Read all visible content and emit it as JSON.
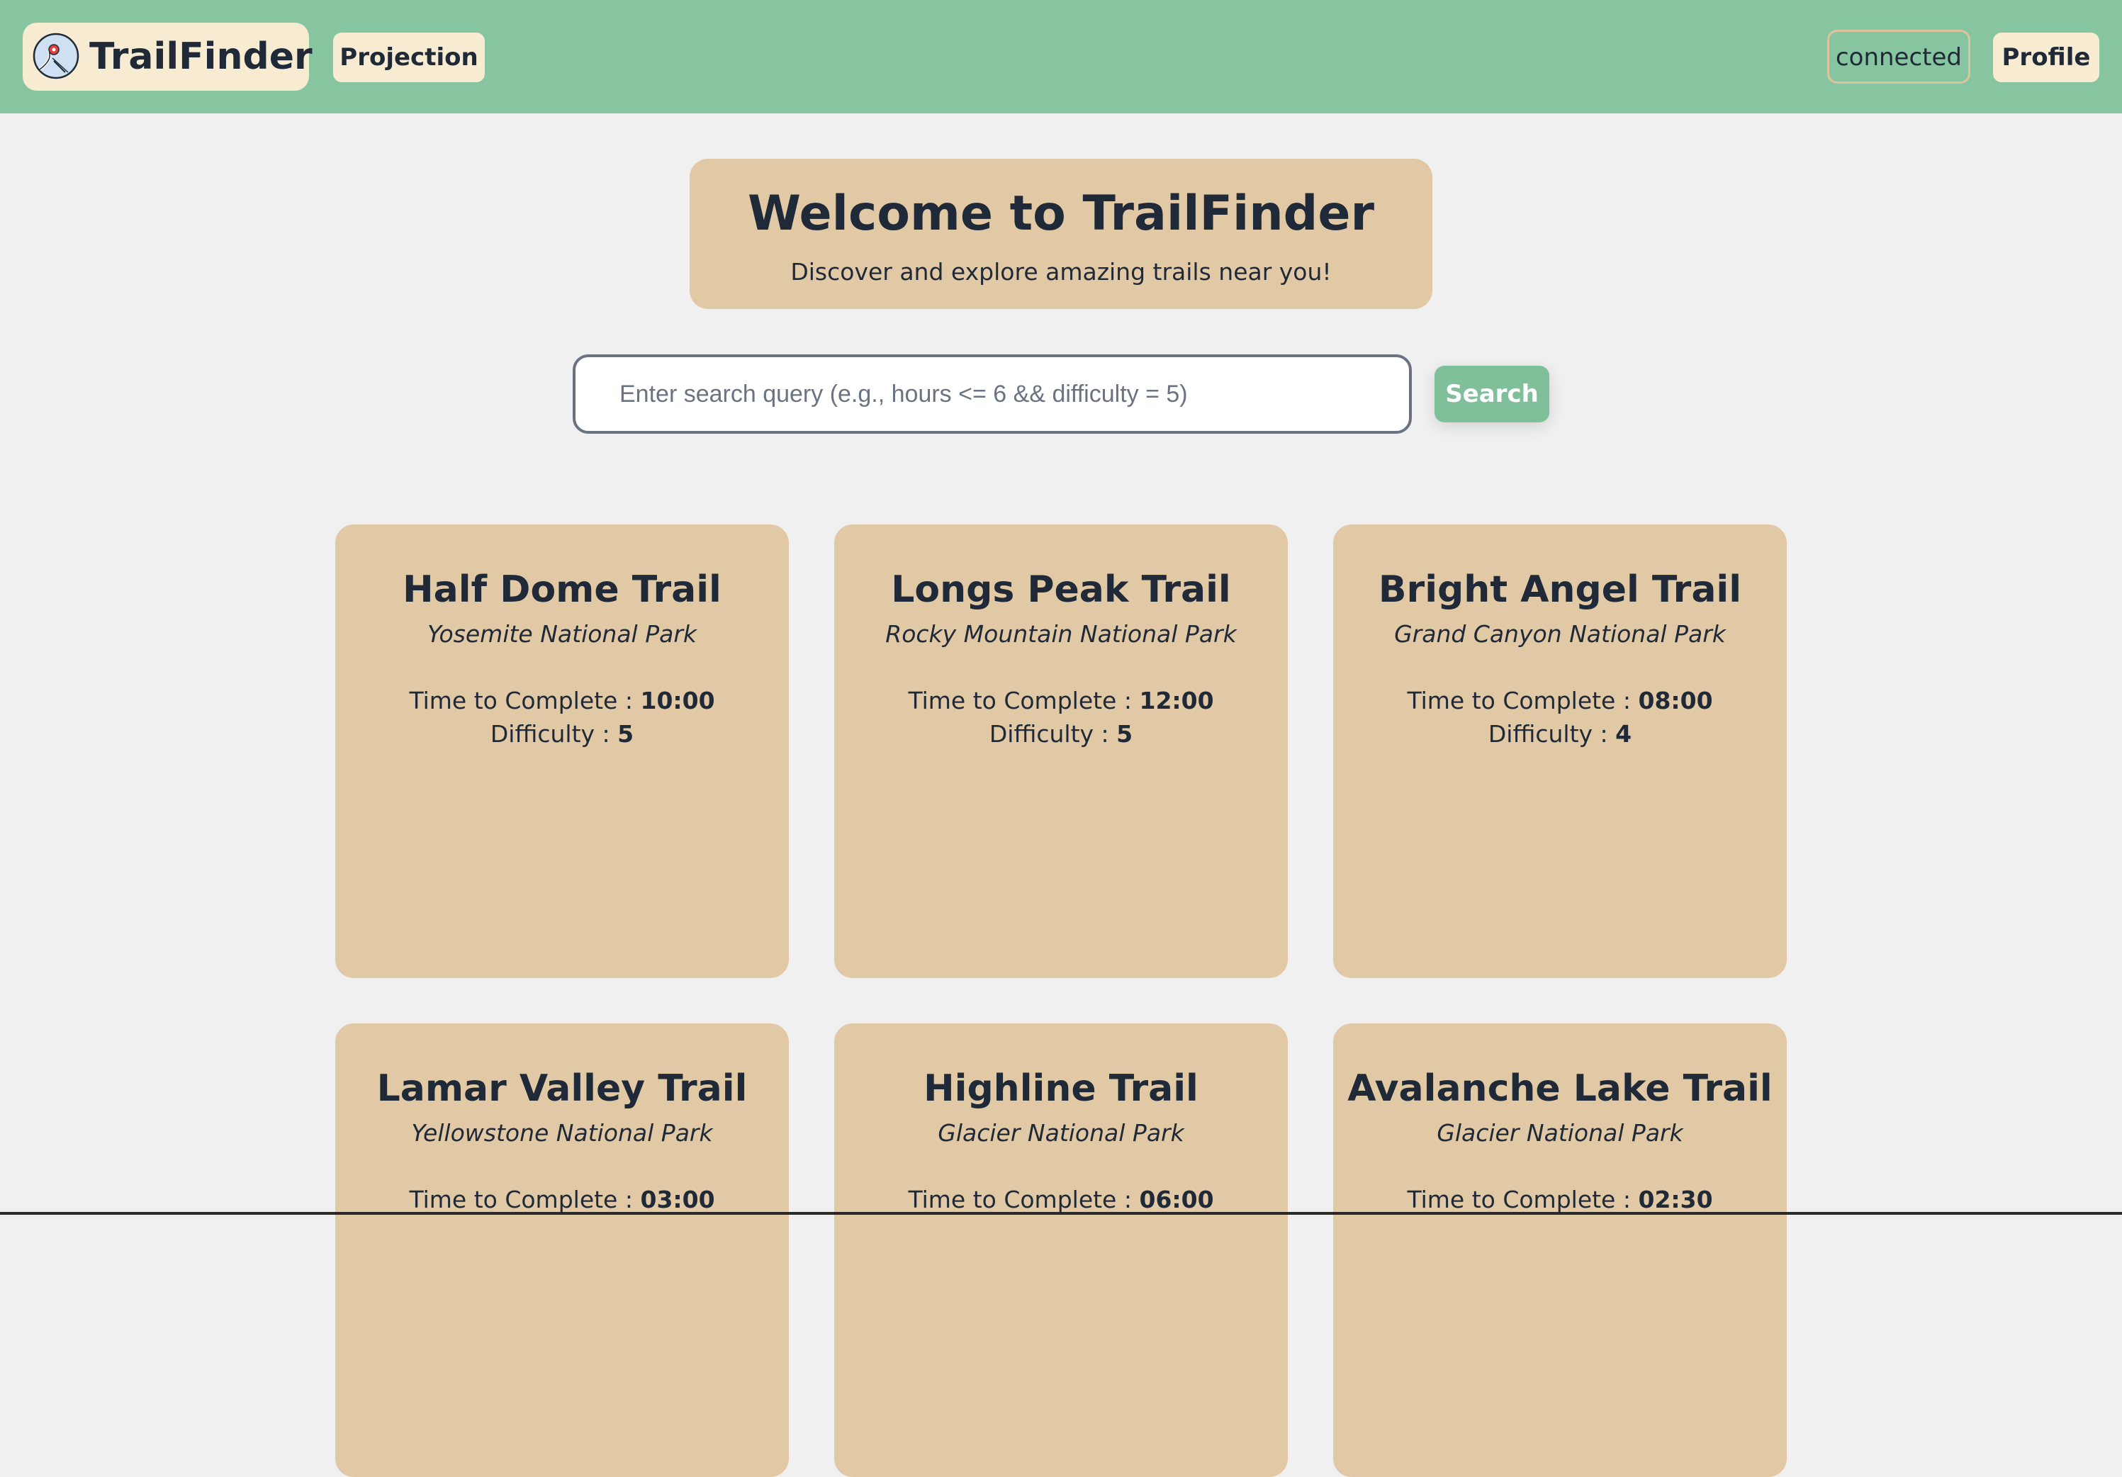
{
  "header": {
    "brand_name": "TrailFinder",
    "logo_icon": "trail-map-pin-logo-icon",
    "nav": {
      "projection_label": "Projection",
      "profile_label": "Profile"
    },
    "status": "connected"
  },
  "hero": {
    "title": "Welcome to TrailFinder",
    "subtitle": "Discover and explore amazing trails near you!"
  },
  "search": {
    "placeholder": "Enter search query (e.g., hours <= 6 && difficulty = 5)",
    "value": "",
    "button_label": "Search"
  },
  "trail_labels": {
    "time": "Time to Complete",
    "difficulty": "Difficulty",
    "separator": ":"
  },
  "trails": [
    {
      "name": "Half Dome Trail",
      "park": "Yosemite National Park",
      "time": "10:00",
      "difficulty": "5"
    },
    {
      "name": "Longs Peak Trail",
      "park": "Rocky Mountain National Park",
      "time": "12:00",
      "difficulty": "5"
    },
    {
      "name": "Bright Angel Trail",
      "park": "Grand Canyon National Park",
      "time": "08:00",
      "difficulty": "4"
    },
    {
      "name": "Lamar Valley Trail",
      "park": "Yellowstone National Park",
      "time": "03:00",
      "difficulty": ""
    },
    {
      "name": "Highline Trail",
      "park": "Glacier National Park",
      "time": "06:00",
      "difficulty": ""
    },
    {
      "name": "Avalanche Lake Trail",
      "park": "Glacier National Park",
      "time": "02:30",
      "difficulty": ""
    }
  ],
  "colors": {
    "header_bg": "#87c5a0",
    "brand_bg": "#f7ebd2",
    "card_bg": "#e2c9a6",
    "search_button_bg": "#7fbf9a",
    "text": "#1f2937",
    "page_bg": "#f0f0f0"
  }
}
